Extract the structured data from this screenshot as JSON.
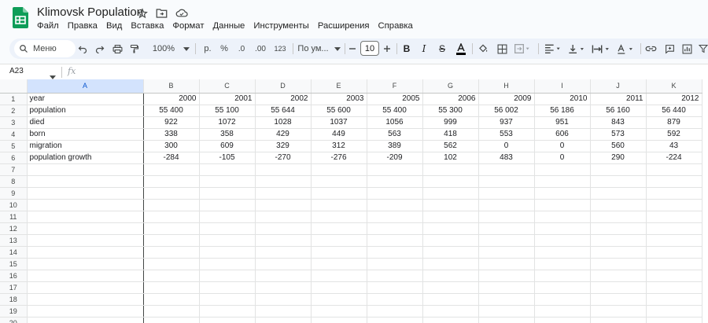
{
  "doc": {
    "title": "Klimovsk Population",
    "menu": [
      "Файл",
      "Правка",
      "Вид",
      "Вставка",
      "Формат",
      "Данные",
      "Инструменты",
      "Расширения",
      "Справка"
    ]
  },
  "toolbar": {
    "search_label": "Меню",
    "zoom": "100%",
    "currency": "р.",
    "percent": "%",
    "dec_decrease": ".0",
    "dec_increase": ".00",
    "number_format": "123",
    "font": "По ум...",
    "font_size": "10"
  },
  "formula": {
    "cell_ref": "A23",
    "fx": "fx"
  },
  "sheet": {
    "columns": [
      "A",
      "B",
      "C",
      "D",
      "E",
      "F",
      "G",
      "H",
      "I",
      "J",
      "K"
    ],
    "row_numbers": [
      "1",
      "2",
      "3",
      "4",
      "5",
      "6",
      "7",
      "8",
      "9",
      "10",
      "11",
      "12",
      "13",
      "14",
      "15",
      "16",
      "17",
      "18",
      "19",
      "20"
    ],
    "rows": [
      [
        "year",
        "2000",
        "2001",
        "2002",
        "2003",
        "2005",
        "2006",
        "2009",
        "2010",
        "2011",
        "2012"
      ],
      [
        "population",
        "55 400",
        "55 100",
        "55 644",
        "55 600",
        "55 400",
        "55 300",
        "56 002",
        "56 186",
        "56 160",
        "56 440"
      ],
      [
        "died",
        "922",
        "1072",
        "1028",
        "1037",
        "1056",
        "999",
        "937",
        "951",
        "843",
        "879"
      ],
      [
        "born",
        "338",
        "358",
        "429",
        "449",
        "563",
        "418",
        "553",
        "606",
        "573",
        "592"
      ],
      [
        "migration",
        "300",
        "609",
        "329",
        "312",
        "389",
        "562",
        "0",
        "0",
        "560",
        "43"
      ],
      [
        "population growth",
        "-284",
        "-105",
        "-270",
        "-276",
        "-209",
        "102",
        "483",
        "0",
        "290",
        "-224"
      ]
    ]
  },
  "colors": {
    "accent": "#0b57d0",
    "logo": "#0f9d58",
    "toolbar_bg": "#edf2fa"
  }
}
